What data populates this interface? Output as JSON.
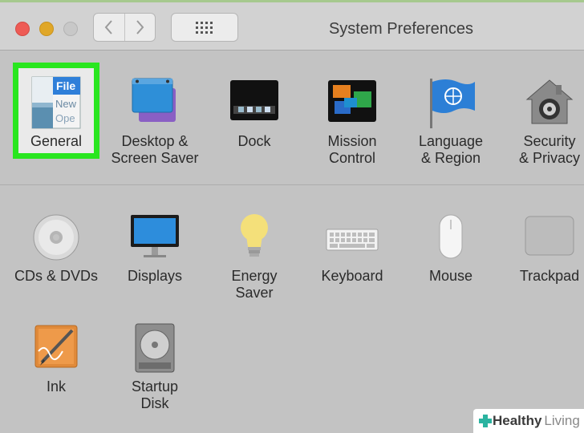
{
  "window": {
    "title": "System Preferences",
    "controls": [
      "close",
      "minimize",
      "zoom"
    ]
  },
  "toolbar": {
    "back_icon": "chevron-left-icon",
    "forward_icon": "chevron-right-icon",
    "show_all_icon": "grid-icon"
  },
  "rows": [
    {
      "items": [
        {
          "id": "general",
          "label": "General",
          "icon": "general-icon",
          "selected": true,
          "icon_text": [
            "File",
            "New",
            "Ope"
          ]
        },
        {
          "id": "desktop-screen-saver",
          "label": "Desktop &\nScreen Saver",
          "icon": "desktop-screen-saver-icon"
        },
        {
          "id": "dock",
          "label": "Dock",
          "icon": "dock-icon"
        },
        {
          "id": "mission-control",
          "label": "Mission\nControl",
          "icon": "mission-control-icon"
        },
        {
          "id": "language-region",
          "label": "Language\n& Region",
          "icon": "language-region-icon"
        },
        {
          "id": "security-privacy",
          "label": "Security\n& Privacy",
          "icon": "security-privacy-icon"
        }
      ]
    },
    {
      "items": [
        {
          "id": "cds-dvds",
          "label": "CDs & DVDs",
          "icon": "cd-dvd-icon"
        },
        {
          "id": "displays",
          "label": "Displays",
          "icon": "displays-icon"
        },
        {
          "id": "energy-saver",
          "label": "Energy\nSaver",
          "icon": "energy-saver-icon"
        },
        {
          "id": "keyboard",
          "label": "Keyboard",
          "icon": "keyboard-icon"
        },
        {
          "id": "mouse",
          "label": "Mouse",
          "icon": "mouse-icon"
        },
        {
          "id": "trackpad",
          "label": "Trackpad",
          "icon": "trackpad-icon"
        }
      ]
    },
    {
      "items": [
        {
          "id": "ink",
          "label": "Ink",
          "icon": "ink-icon"
        },
        {
          "id": "startup-disk",
          "label": "Startup\nDisk",
          "icon": "startup-disk-icon"
        }
      ]
    }
  ],
  "watermark": {
    "brand_a": "Healthy",
    "brand_b": "Living",
    "icon": "cross-icon"
  },
  "colors": {
    "selection": "#29e61f",
    "background": "#c3c3c3",
    "titlebar": "#d2d2d2"
  }
}
